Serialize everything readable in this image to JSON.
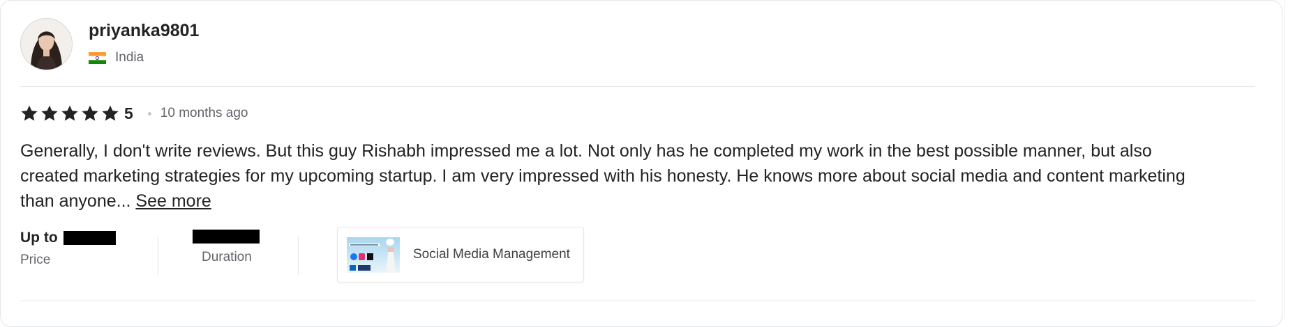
{
  "review": {
    "user": {
      "username": "priyanka9801",
      "country": "India",
      "avatar_icon": "user-avatar-photo",
      "flag_icon": "india-flag-icon"
    },
    "rating": {
      "stars": 5,
      "value": "5",
      "time_ago": "10 months ago"
    },
    "text": "Generally, I don't write reviews. But this guy Rishabh impressed me a lot. Not only has he completed my work in the best possible manner, but also created marketing strategies for my upcoming startup. I am very impressed with his honesty. He knows more about social media and content marketing than anyone...",
    "see_more_label": "See more",
    "price": {
      "prefix": "Up to",
      "label": "Price"
    },
    "duration": {
      "label": "Duration"
    },
    "gig": {
      "title": "Social Media Management"
    }
  },
  "colors": {
    "text_primary": "#222325",
    "text_secondary": "#62646a",
    "divider": "#e4e5e7",
    "star": "#222325"
  }
}
